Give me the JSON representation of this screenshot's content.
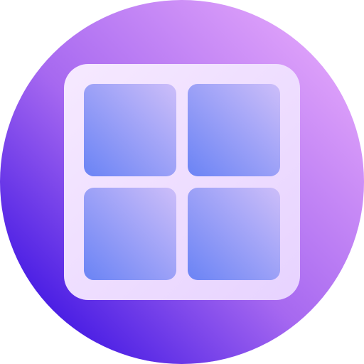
{
  "icon": {
    "name": "window-grid-icon",
    "colors": {
      "circle_top_right": "#e3a6fb",
      "circle_mid": "#a668f0",
      "circle_bottom_left": "#3b12e2",
      "frame_outer": "#f6e9ff",
      "frame_inner": "#e7d3ff",
      "pane_light": "#c8bbf9",
      "pane_dark": "#6f86f5"
    },
    "panes": [
      "top-left",
      "top-right",
      "bottom-left",
      "bottom-right"
    ]
  }
}
